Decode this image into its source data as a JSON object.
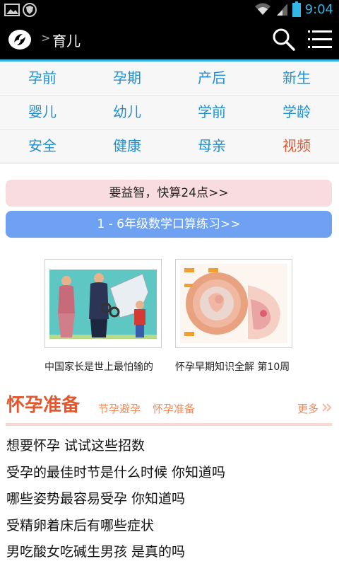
{
  "status_bar": {
    "time": "9:04"
  },
  "app_bar": {
    "separator": ">",
    "title": "育儿"
  },
  "categories": [
    [
      "孕前",
      "孕期",
      "产后",
      "新生"
    ],
    [
      "婴儿",
      "幼儿",
      "学前",
      "学龄"
    ],
    [
      "安全",
      "健康",
      "母亲",
      "视频"
    ]
  ],
  "promos": {
    "puzzle": "要益智，快算24点>>",
    "math": "1 - 6年级数学口算练习>>"
  },
  "cards": [
    {
      "caption": "中国家长是世上最怕输的"
    },
    {
      "caption": "怀孕早期知识全解 第10周"
    }
  ],
  "section": {
    "title": "怀孕准备",
    "tags": [
      "节孕避孕",
      "怀孕准备"
    ],
    "more": "更多"
  },
  "articles": [
    "想要怀孕 试试这些招数",
    "受孕的最佳时节是什么时候 你知道吗",
    "哪些姿势最容易受孕 你知道吗",
    "受精卵着床后有哪些症状",
    "男吃酸女吃碱生男孩 是真的吗"
  ],
  "colors": {
    "accent": "#33b5e5",
    "section": "#e4572e",
    "link": "#1f8fcf",
    "promo_pink": "#f8dcdf",
    "promo_blue": "#6ea1f2"
  }
}
